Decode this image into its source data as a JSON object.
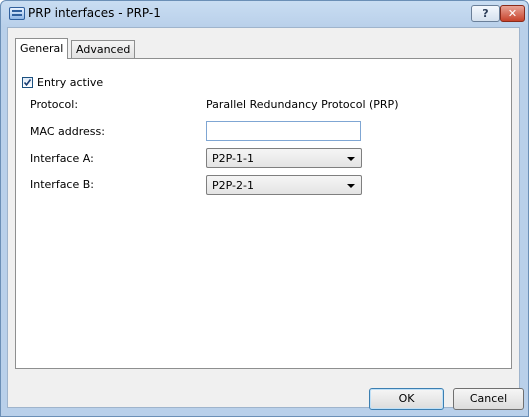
{
  "window": {
    "title": "PRP interfaces - PRP-1",
    "help_label": "?",
    "close_label": "✕"
  },
  "tabs": [
    {
      "label": "General",
      "selected": true
    },
    {
      "label": "Advanced",
      "selected": false
    }
  ],
  "form": {
    "entry_active_label": "Entry active",
    "entry_active_checked": true,
    "protocol_label": "Protocol:",
    "protocol_value": "Parallel Redundancy Protocol (PRP)",
    "mac_label": "MAC address:",
    "mac_value": "",
    "interface_a_label": "Interface A:",
    "interface_a_value": "P2P-1-1",
    "interface_b_label": "Interface B:",
    "interface_b_value": "P2P-2-1"
  },
  "buttons": {
    "ok": "OK",
    "cancel": "Cancel"
  }
}
